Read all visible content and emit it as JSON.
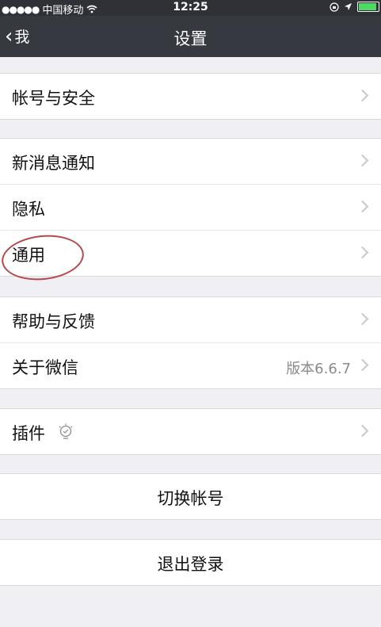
{
  "status_bar": {
    "signal_dots": "●●●●●",
    "carrier": "中国移动",
    "time": "12:25"
  },
  "nav": {
    "back_label": "我",
    "title": "设置"
  },
  "groups": [
    {
      "items": [
        {
          "label": "帐号与安全"
        }
      ]
    },
    {
      "items": [
        {
          "label": "新消息通知"
        },
        {
          "label": "隐私"
        },
        {
          "label": "通用"
        }
      ]
    },
    {
      "items": [
        {
          "label": "帮助与反馈"
        },
        {
          "label": "关于微信",
          "value": "版本6.6.7"
        }
      ]
    },
    {
      "items": [
        {
          "label": "插件",
          "icon": "bulb-icon"
        }
      ]
    }
  ],
  "actions": {
    "switch_account": "切换帐号",
    "logout": "退出登录"
  },
  "colors": {
    "nav_background": "#363a40",
    "page_background": "#efeff4",
    "annotation_circle": "#b5474c"
  }
}
